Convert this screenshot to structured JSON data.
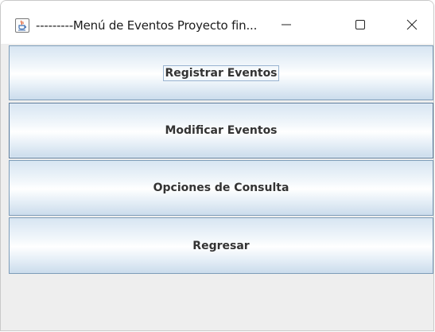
{
  "window": {
    "title": "---------Menú de Eventos Proyecto fin...",
    "app_icon": "java-cup-icon",
    "controls": [
      "minimize-icon",
      "maximize-icon",
      "close-icon"
    ]
  },
  "menu": {
    "buttons": [
      {
        "label": "Registrar Eventos",
        "state": "focused"
      },
      {
        "label": "Modificar Eventos",
        "state": "hover"
      },
      {
        "label": "Opciones de Consulta",
        "state": "normal"
      },
      {
        "label": "Regresar",
        "state": "normal"
      }
    ]
  },
  "colors": {
    "button_border": "#7e9db9",
    "button_gradient_top": "#d7e5f2",
    "button_gradient_bottom": "#cbdcec",
    "panel_background": "#eeeeee",
    "text": "#333333"
  }
}
